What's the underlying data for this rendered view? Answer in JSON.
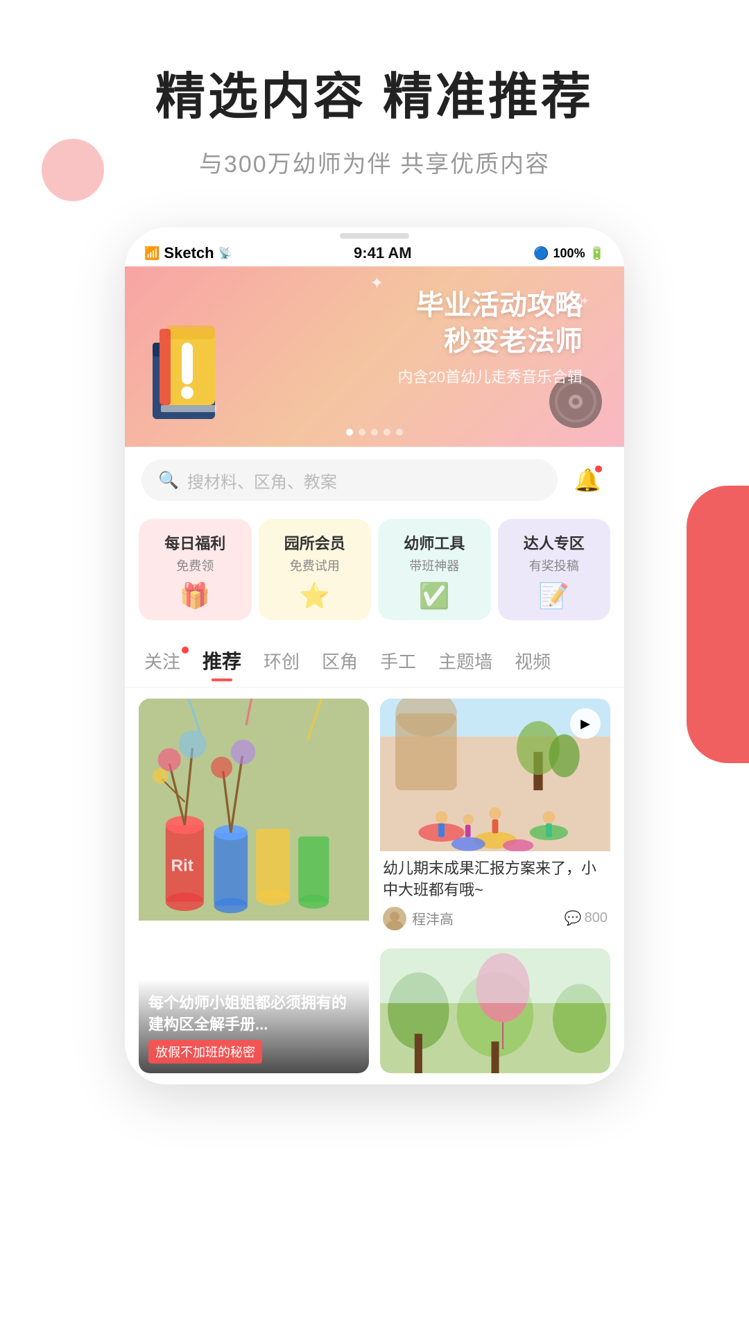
{
  "hero": {
    "title": "精选内容 精准推荐",
    "subtitle": "与300万幼师为伴 共享优质内容"
  },
  "phone": {
    "statusBar": {
      "carrier": "Sketch",
      "time": "9:41 AM",
      "battery": "100%"
    },
    "banner": {
      "line1": "毕业活动攻略",
      "line2": "秒变老法师",
      "subtitle": "内含20首幼儿走秀音乐合辑",
      "dots": [
        true,
        false,
        false,
        false,
        false
      ]
    },
    "search": {
      "placeholder": "搜材料、区角、教案",
      "notificationLabel": "通知"
    },
    "features": [
      {
        "title": "每日福利",
        "subtitle": "免费领",
        "color": "pink",
        "icon": "🎁"
      },
      {
        "title": "园所会员",
        "subtitle": "免费试用",
        "color": "yellow",
        "icon": "⭐"
      },
      {
        "title": "幼师工具",
        "subtitle": "带班神器",
        "color": "mint",
        "icon": "✓"
      },
      {
        "title": "达人专区",
        "subtitle": "有奖投稿",
        "color": "lavender",
        "icon": "≡"
      }
    ],
    "tabs": [
      {
        "label": "关注",
        "active": false,
        "dot": true
      },
      {
        "label": "推荐",
        "active": true,
        "dot": false
      },
      {
        "label": "环创",
        "active": false,
        "dot": false
      },
      {
        "label": "区角",
        "active": false,
        "dot": false
      },
      {
        "label": "手工",
        "active": false,
        "dot": false
      },
      {
        "label": "主题墙",
        "active": false,
        "dot": false
      },
      {
        "label": "视频",
        "active": false,
        "dot": false
      }
    ],
    "cards": [
      {
        "id": "craft",
        "type": "left-tall",
        "overlayText": "每个幼师小姐姐都必须拥有的建构区全解手册...",
        "tag": "放假不加班的秘密",
        "hasOverlay": true
      },
      {
        "id": "outdoor",
        "type": "right-short",
        "title": "幼儿期末成果汇报方案来了，小中大班都有哦~",
        "author": "程沣高",
        "likes": "800",
        "hasVideo": true
      }
    ]
  }
}
